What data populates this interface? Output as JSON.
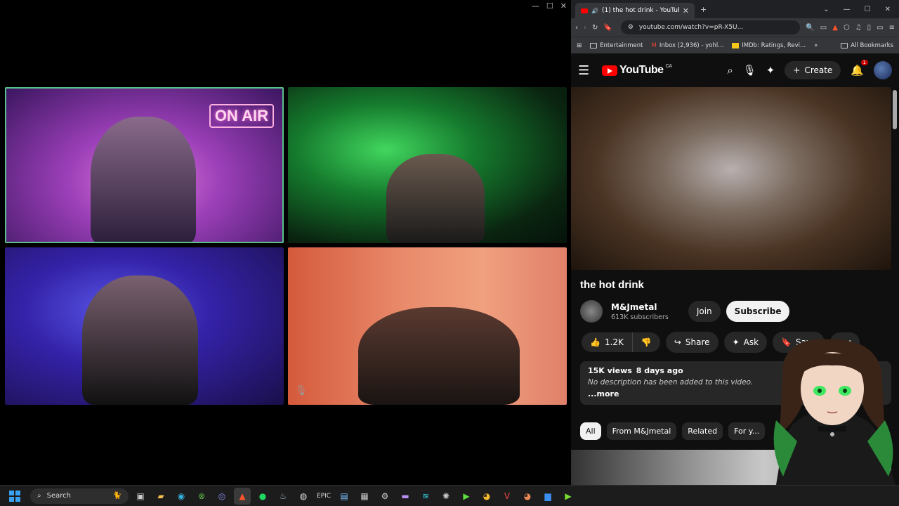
{
  "call": {
    "window_controls": [
      "—",
      "☐",
      "✕"
    ],
    "tile1_sign": "ON AIR"
  },
  "browser": {
    "tab_title": "(1) the hot drink - YouTube",
    "tab_close": "✕",
    "new_tab": "+",
    "window_controls": [
      "⌄",
      "—",
      "☐",
      "✕"
    ],
    "url": "youtube.com/watch?v=pR-X5U...",
    "bookmarks": [
      {
        "label": "Entertainment",
        "icon": "folder-icon"
      },
      {
        "label": "Inbox (2,936) - yohl...",
        "icon": "gmail-icon"
      },
      {
        "label": "IMDb: Ratings, Revi...",
        "icon": "imdb-icon"
      }
    ],
    "bookmarks_overflow": "»",
    "all_bookmarks": "All Bookmarks"
  },
  "youtube": {
    "logo_text": "YouTube",
    "country": "CA",
    "create_label": "Create",
    "notif_count": "1",
    "video_title": "the hot drink",
    "channel_name": "M&Jmetal",
    "subscribers": "613K subscribers",
    "join_label": "Join",
    "subscribe_label": "Subscribe",
    "likes": "1.2K",
    "share_label": "Share",
    "ask_label": "Ask",
    "save_label": "Save",
    "more_label": "•••",
    "views": "15K views",
    "date": "8 days ago",
    "description": "No description has been added to this video.",
    "desc_more": "...more",
    "chips": [
      {
        "label": "All",
        "active": true
      },
      {
        "label": "From M&Jmetal",
        "active": false
      },
      {
        "label": "Related",
        "active": false
      },
      {
        "label": "For y...",
        "active": false
      }
    ]
  },
  "taskbar": {
    "search_label": "Search"
  },
  "colors": {
    "yt_red": "#ff0000",
    "active_speaker_border": "#56c28a",
    "windows_blue": "#3aa0f0"
  }
}
